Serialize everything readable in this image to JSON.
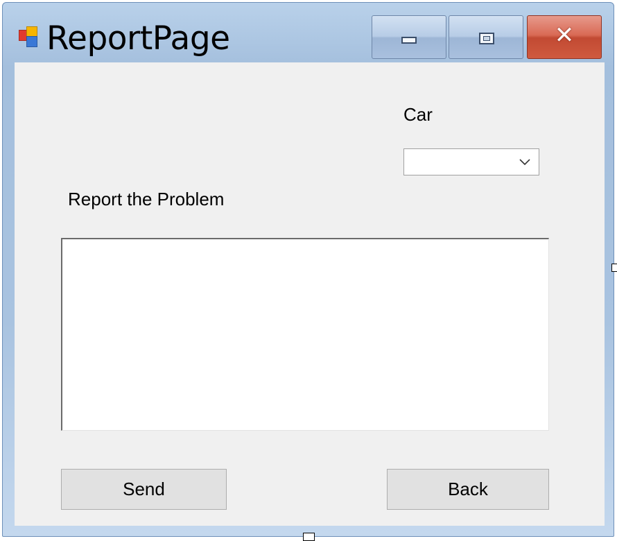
{
  "window": {
    "title": "ReportPage",
    "app_icon": "windows-form-icon",
    "caption_buttons": {
      "minimize_icon": "minimize-icon",
      "maximize_icon": "maximize-icon",
      "close_icon": "close-icon",
      "close_glyph": "✕"
    }
  },
  "form": {
    "car_label": "Car",
    "car_select": {
      "value": "",
      "chevron_icon": "chevron-down-icon"
    },
    "report_label": "Report the Problem",
    "report_text": "",
    "send_label": "Send",
    "back_label": "Back"
  },
  "colors": {
    "client_background": "#f0f0f0",
    "close_button": "#c24a33",
    "titlebar": "#a4bfdd"
  }
}
